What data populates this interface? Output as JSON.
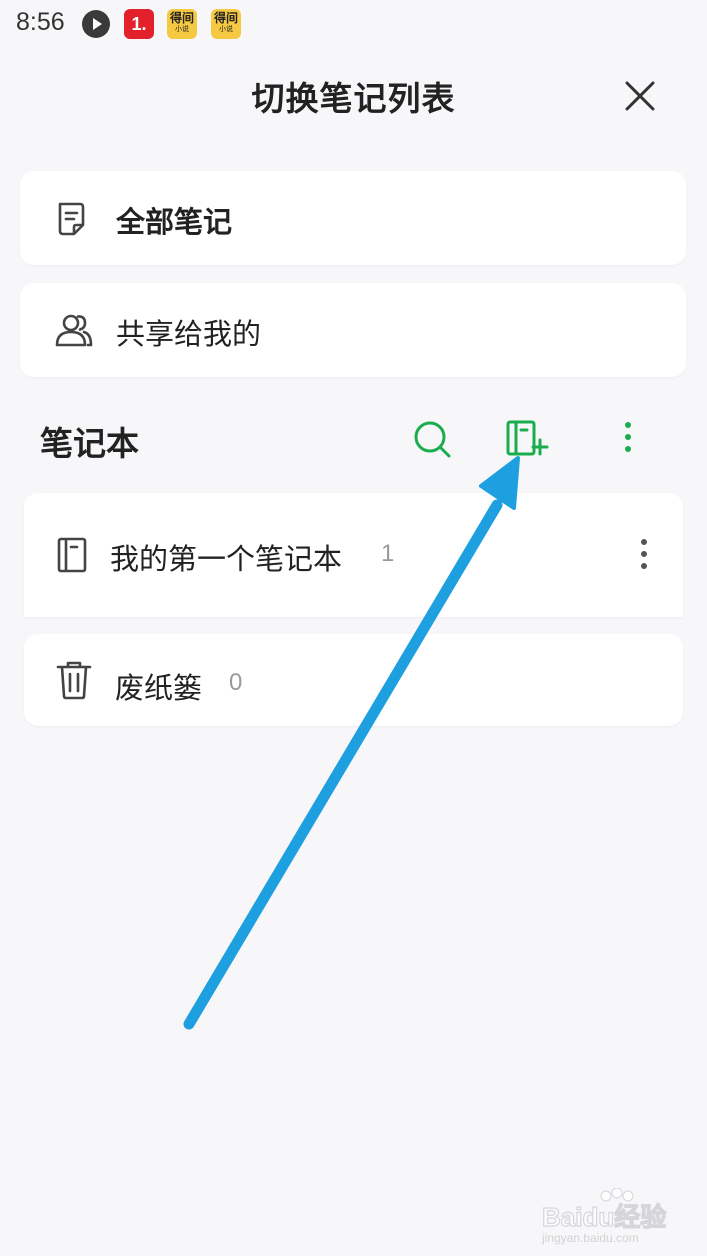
{
  "status_bar": {
    "time": "8:56",
    "icons": [
      "play-icon",
      "app-1-icon",
      "novel-app-icon",
      "novel-app-icon"
    ],
    "app_one_label": "1.",
    "novel_label": "得间",
    "novel_sub": "小说"
  },
  "header": {
    "title": "切换笔记列表",
    "close_icon": "close-icon"
  },
  "lists": {
    "all_notes": {
      "label": "全部笔记",
      "icon": "note-icon"
    },
    "shared": {
      "label": "共享给我的",
      "icon": "people-icon"
    }
  },
  "notebooks": {
    "section_title": "笔记本",
    "actions": [
      "search-icon",
      "new-notebook-icon",
      "more-vertical-icon"
    ],
    "items": [
      {
        "label": "我的第一个笔记本",
        "count": "1",
        "icon": "notebook-icon"
      }
    ],
    "trash": {
      "label": "废纸篓",
      "count": "0",
      "icon": "trash-icon"
    }
  },
  "colors": {
    "accent": "#1aad4e",
    "annotation_arrow": "#1ea0e0",
    "background": "#f7f7f9"
  },
  "watermark": {
    "text": "Baidu经验",
    "sub": "jingyan.baidu.com"
  }
}
